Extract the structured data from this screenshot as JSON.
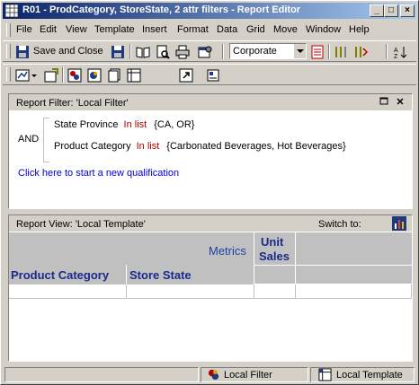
{
  "window": {
    "title": "R01 - ProdCategory, StoreState, 2 attr filters - Report Editor",
    "minimize_glyph": "_",
    "maximize_glyph": "□",
    "close_glyph": "×"
  },
  "menu": [
    {
      "label": "File"
    },
    {
      "label": "Edit"
    },
    {
      "label": "View"
    },
    {
      "label": "Template"
    },
    {
      "label": "Insert"
    },
    {
      "label": "Format"
    },
    {
      "label": "Data"
    },
    {
      "label": "Grid"
    },
    {
      "label": "Move"
    },
    {
      "label": "Window"
    },
    {
      "label": "Help"
    }
  ],
  "toolbar": {
    "save_close_label": "Save and Close",
    "style_combo_value": "Corporate"
  },
  "report_filter": {
    "title": "Report Filter: 'Local Filter'",
    "operator": "AND",
    "conditions": [
      {
        "attribute": "State Province",
        "op": "In list",
        "values": "{CA, OR}"
      },
      {
        "attribute": "Product Category",
        "op": "In list",
        "values": "{Carbonated Beverages, Hot Beverages}"
      }
    ],
    "new_qualification_link": "Click here to start a new qualification"
  },
  "report_view": {
    "title": "Report View: 'Local Template'",
    "switch_to_label": "Switch to:",
    "metrics_label": "Metrics",
    "metric_header_line1": "Unit",
    "metric_header_line2": "Sales",
    "row_headers": [
      "Product Category",
      "Store State"
    ]
  },
  "status_bar": {
    "local_filter": "Local Filter",
    "local_template": "Local Template"
  },
  "colors": {
    "title_bar_start": "#0a246a",
    "title_bar_end": "#a6caf0",
    "header_text_blue": "#1a2a8a",
    "link_blue": "#0000cc",
    "operator_red": "#b00000",
    "grid_header_gray": "#c0c0c0"
  }
}
